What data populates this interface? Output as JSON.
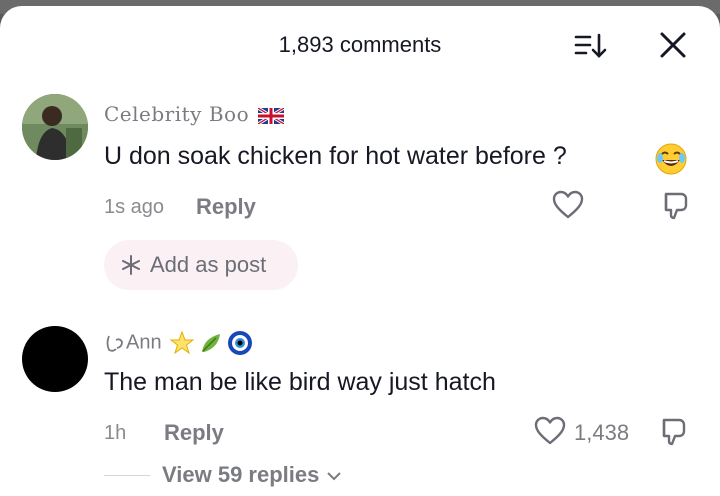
{
  "header": {
    "title": "1,893 comments",
    "sort_icon": "sort-icon",
    "close_icon": "close-icon"
  },
  "comments": [
    {
      "username": "Celebrity Boo",
      "username_badge": "uk-flag",
      "text": "U don soak chicken for hot water before ?",
      "trailing_emoji": "laughing-face",
      "time": "1s ago",
      "reply_label": "Reply",
      "like_count": "",
      "add_post_label": "Add as post"
    },
    {
      "username": "Ann",
      "username_prefix_icon": "outlined-glyph",
      "username_badges": [
        "star",
        "leaf",
        "nazar-amulet"
      ],
      "text": "The man be like bird way just hatch",
      "time": "1h",
      "reply_label": "Reply",
      "like_count": "1,438",
      "view_replies_label": "View 59 replies"
    }
  ],
  "colors": {
    "text_primary": "#161823",
    "text_secondary": "#7b7c82",
    "add_post_bg": "#fbf1f5",
    "sheet_bg": "#ffffff"
  }
}
